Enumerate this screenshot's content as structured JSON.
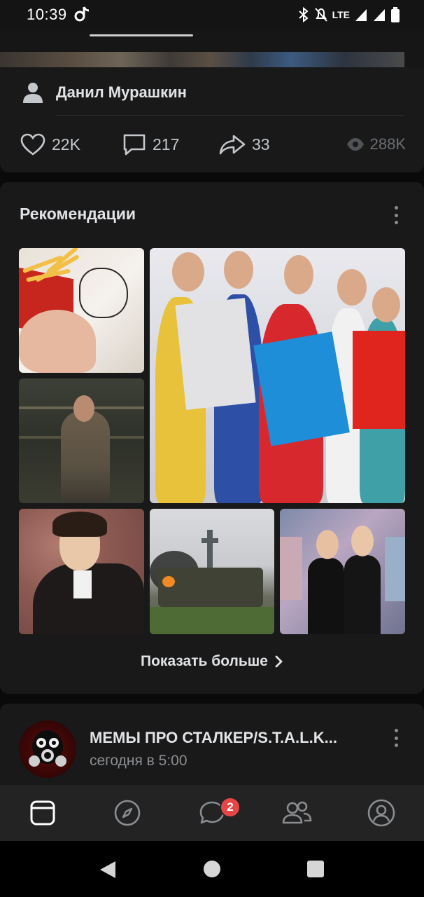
{
  "status_bar": {
    "time": "10:39",
    "network": "LTE",
    "icons": [
      "tiktok-icon",
      "bluetooth-icon",
      "mute-icon",
      "signal-icon",
      "battery-icon"
    ]
  },
  "previous_post": {
    "author_name": "Данил Мурашкин",
    "likes": "22K",
    "comments": "217",
    "shares": "33",
    "views": "288K"
  },
  "recommendations": {
    "title": "Рекомендации",
    "show_more_label": "Показать больше",
    "tiles": [
      {
        "name": "fries-photo"
      },
      {
        "name": "students-with-letters-photo"
      },
      {
        "name": "game-character-photo"
      },
      {
        "name": "pushkin-portrait-photo"
      },
      {
        "name": "burning-tank-photo"
      },
      {
        "name": "girls-photo"
      }
    ]
  },
  "next_post": {
    "group_name": "МЕМЫ ПРО СТАЛКЕР/S.T.A.L.K...",
    "time": "сегодня в 5:00"
  },
  "tab_bar": {
    "tabs": [
      "feed-icon",
      "explore-icon",
      "messages-icon",
      "friends-icon",
      "profile-icon"
    ],
    "messages_badge": "2"
  },
  "colors": {
    "background": "#0a0a0a",
    "card": "#191919",
    "tab_bar": "#232323",
    "badge": "#e64646",
    "text_primary": "#e1e3e6",
    "text_secondary": "#8a8d91"
  }
}
